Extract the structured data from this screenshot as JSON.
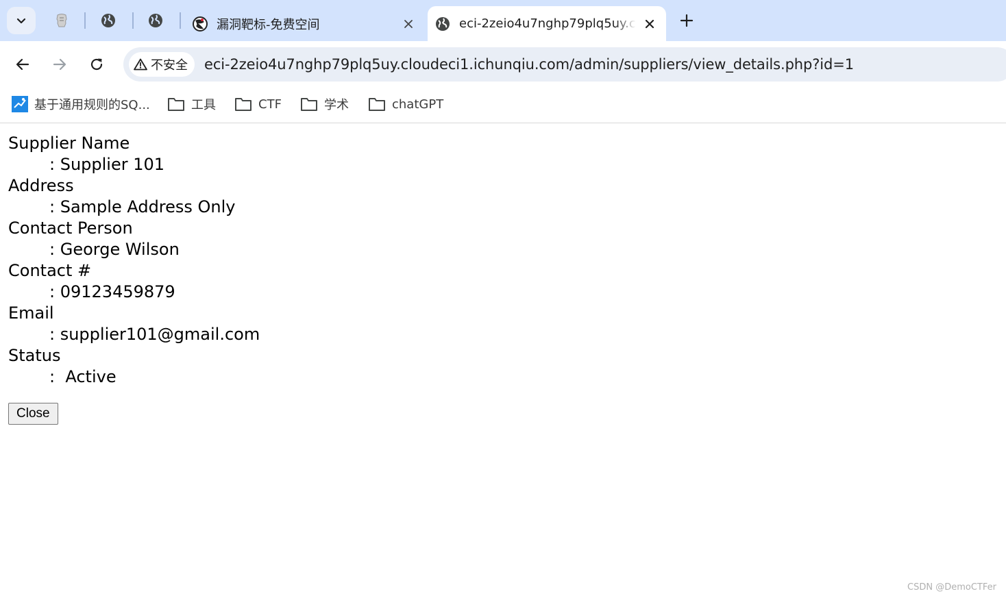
{
  "browser": {
    "tabs": [
      {
        "title": "漏洞靶标-免费空间",
        "active": false,
        "favicon": "target-logo-icon"
      },
      {
        "title": "eci-2zeio4u7nghp79plq5uy.c",
        "active": true,
        "favicon": "globe-icon"
      }
    ],
    "pinned_tabs": [
      "extension-icon",
      "globe-icon",
      "globe-icon"
    ],
    "address_bar": {
      "security_label": "不安全",
      "url": "eci-2zeio4u7nghp79plq5uy.cloudeci1.ichunqiu.com/admin/suppliers/view_details.php?id=1"
    },
    "bookmarks": [
      {
        "label": "基于通用规则的SQ...",
        "icon": "site-favicon"
      },
      {
        "label": "工具",
        "icon": "folder-icon"
      },
      {
        "label": "CTF",
        "icon": "folder-icon"
      },
      {
        "label": "学术",
        "icon": "folder-icon"
      },
      {
        "label": "chatGPT",
        "icon": "folder-icon"
      }
    ]
  },
  "details": [
    {
      "label": "Supplier Name",
      "value": ": Supplier 101"
    },
    {
      "label": "Address",
      "value": ": Sample Address Only"
    },
    {
      "label": "Contact Person",
      "value": ": George Wilson"
    },
    {
      "label": "Contact #",
      "value": ": 09123459879"
    },
    {
      "label": "Email",
      "value": ": supplier101@gmail.com"
    },
    {
      "label": "Status",
      "value": ":  Active"
    }
  ],
  "close_label": "Close",
  "watermark": "CSDN @DemoCTFer",
  "colors": {
    "tabstrip": "#d3e3fd",
    "omnibox": "#e9eef6",
    "icon": "#444746"
  }
}
